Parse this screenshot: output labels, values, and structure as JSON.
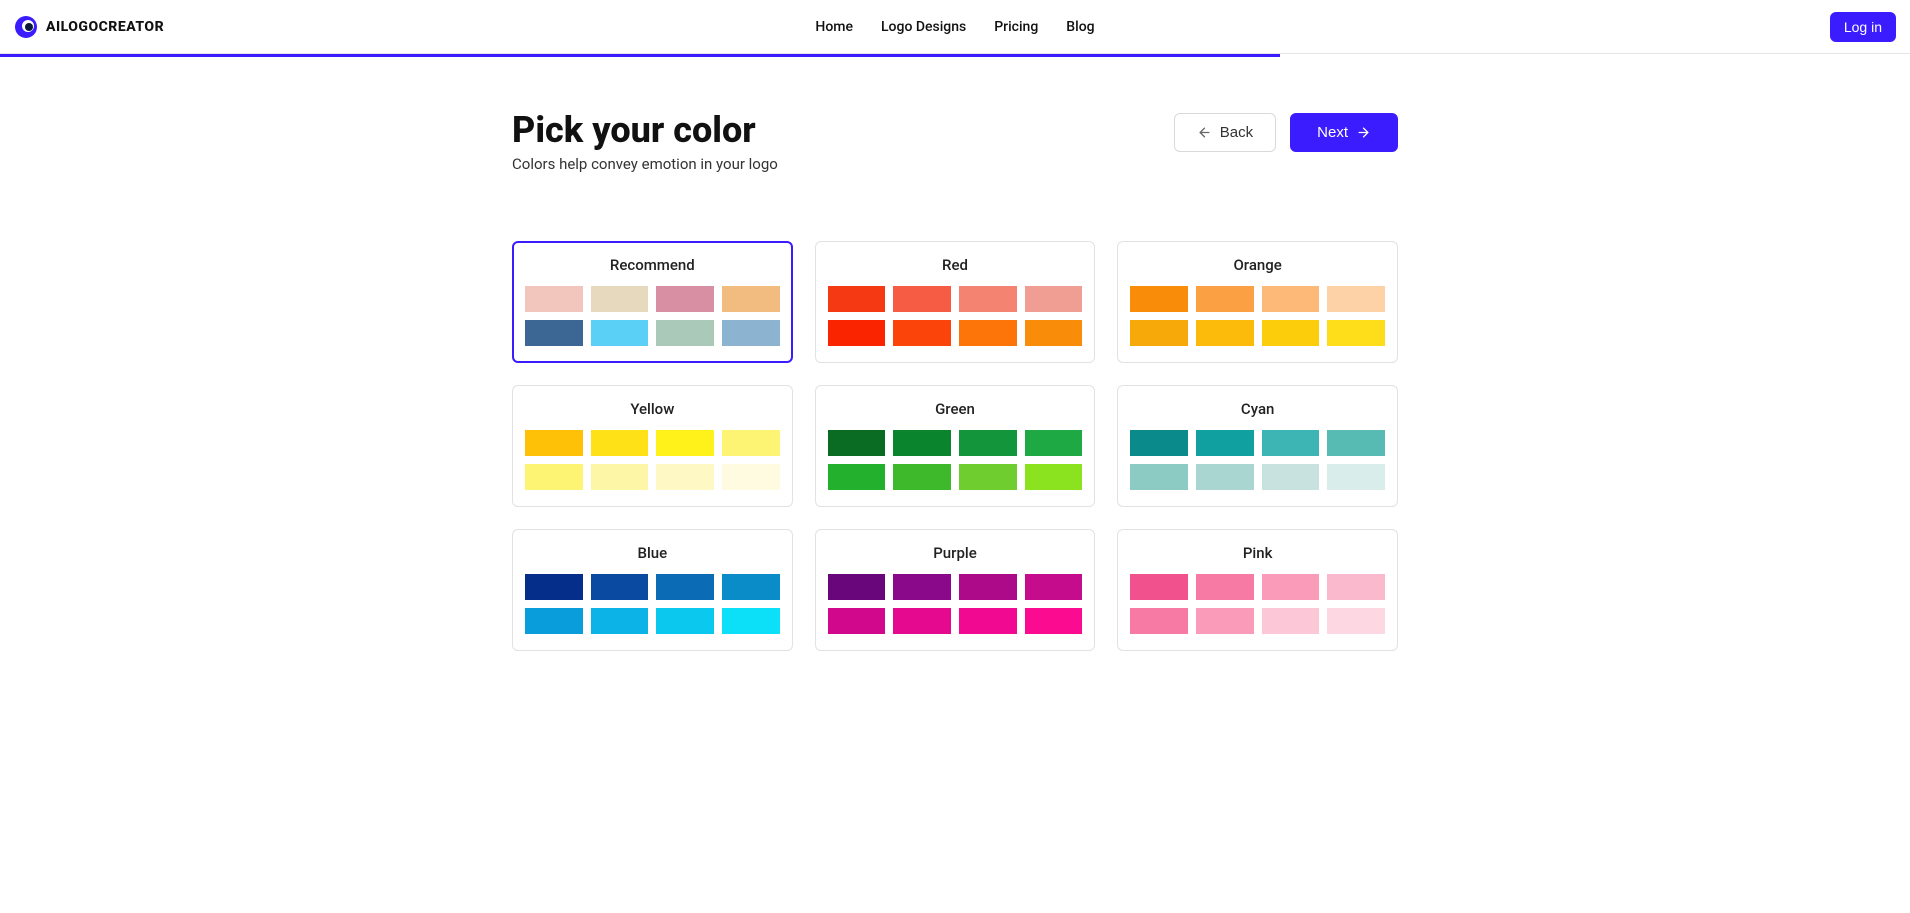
{
  "brand": "AILOGOCREATOR",
  "nav": {
    "home": "Home",
    "logo_designs": "Logo Designs",
    "pricing": "Pricing",
    "blog": "Blog"
  },
  "auth": {
    "login": "Log in"
  },
  "progress": {
    "percent": 67
  },
  "page": {
    "title": "Pick your color",
    "subtitle": "Colors help convey emotion in your logo",
    "back": "Back",
    "next": "Next"
  },
  "selected_index": 0,
  "groups": [
    {
      "name": "Recommend",
      "colors": [
        "#f3c6bd",
        "#e7d9bd",
        "#d98fa3",
        "#f2bb7f",
        "#3c6693",
        "#5bd0f6",
        "#aac9b8",
        "#8cb3d0"
      ]
    },
    {
      "name": "Red",
      "colors": [
        "#f53912",
        "#f65b44",
        "#f58371",
        "#f09e93",
        "#fb2400",
        "#fb4409",
        "#fd7408",
        "#f98d09"
      ]
    },
    {
      "name": "Orange",
      "colors": [
        "#f98d09",
        "#fca143",
        "#fcb977",
        "#fdd2a7",
        "#f6a908",
        "#fcbb0b",
        "#fccd0a",
        "#fede1b"
      ]
    },
    {
      "name": "Yellow",
      "colors": [
        "#ffc107",
        "#ffe117",
        "#fff21a",
        "#fdf474",
        "#fdf474",
        "#fdf6a7",
        "#fdf8c4",
        "#fefbe0"
      ]
    },
    {
      "name": "Green",
      "colors": [
        "#0a6b23",
        "#0b852d",
        "#12953b",
        "#1ea945",
        "#23b02d",
        "#3eb92c",
        "#6fcd2f",
        "#8be21e"
      ]
    },
    {
      "name": "Cyan",
      "colors": [
        "#0a8a8a",
        "#11a0a0",
        "#3eb5b5",
        "#57bbb3",
        "#8ccac4",
        "#a9d6d0",
        "#c8e3df",
        "#d9edea"
      ]
    },
    {
      "name": "Blue",
      "colors": [
        "#042e8a",
        "#0a4aa0",
        "#0b6cb5",
        "#0a8cc9",
        "#0a9ddb",
        "#0bb3e6",
        "#0bc8ee",
        "#0be0f8"
      ]
    },
    {
      "name": "Purple",
      "colors": [
        "#6a067c",
        "#8a088a",
        "#ad0a8a",
        "#c50c8c",
        "#d2088c",
        "#e4098f",
        "#f10a91",
        "#fb0b8f"
      ]
    },
    {
      "name": "Pink",
      "colors": [
        "#f1518c",
        "#f77aa4",
        "#f99bb9",
        "#fbb9ce",
        "#f77aa4",
        "#f99bb9",
        "#fcc7d6",
        "#fdd8e3"
      ]
    }
  ]
}
